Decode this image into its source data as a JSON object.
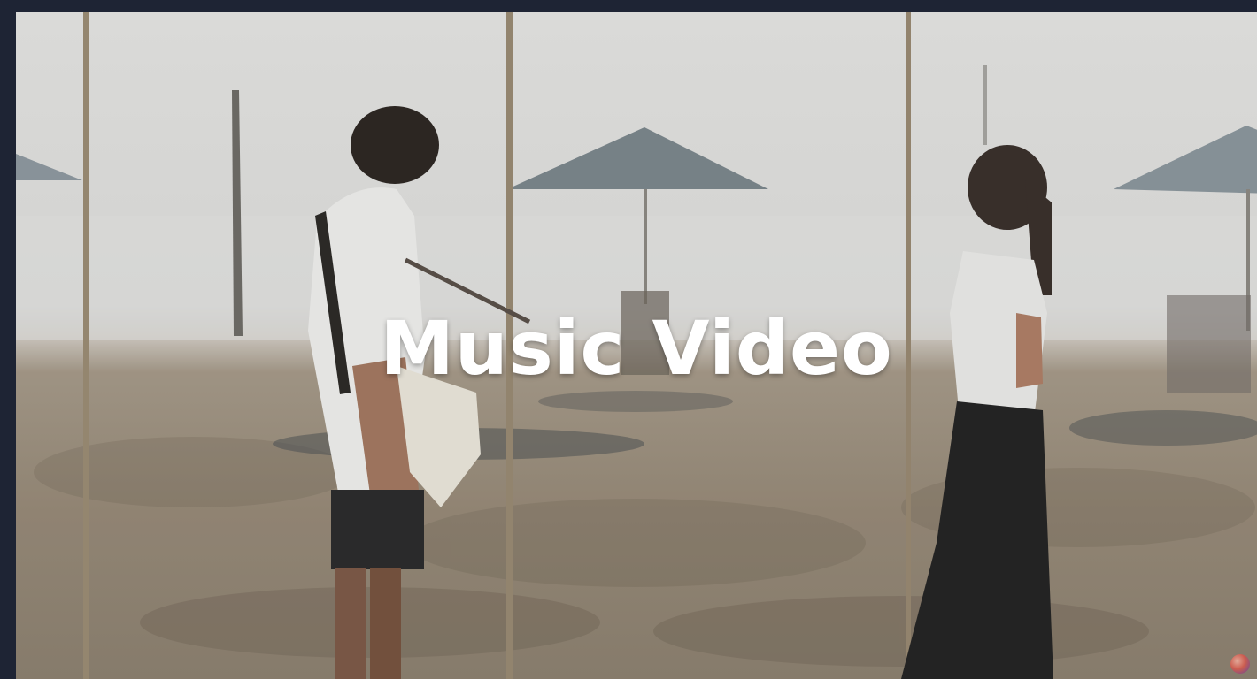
{
  "tile": {
    "title": "Music Video"
  },
  "icons": {
    "badge": "channel-logo-icon"
  },
  "colors": {
    "frame_background": "#1e2434",
    "title_text": "#ffffff"
  }
}
